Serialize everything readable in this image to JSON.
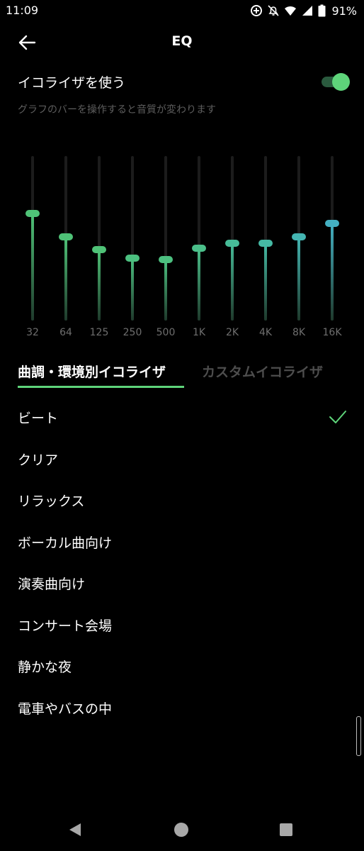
{
  "status_bar": {
    "time": "11:09",
    "battery_percent": "91%",
    "icons": [
      "data-saver-icon",
      "notifications-off-icon",
      "wifi-icon",
      "signal-icon",
      "battery-icon"
    ]
  },
  "header": {
    "title": "EQ",
    "back_icon": "arrow-left-icon"
  },
  "equalizer_toggle": {
    "label": "イコライザを使う",
    "enabled": true,
    "description": "グラフのバーを操作すると音質が変わります"
  },
  "eq_bands": [
    {
      "freq": "32",
      "level": 0.65,
      "color": "#4fc277"
    },
    {
      "freq": "64",
      "level": 0.51,
      "color": "#4fc277"
    },
    {
      "freq": "125",
      "level": 0.43,
      "color": "#4fc277"
    },
    {
      "freq": "250",
      "level": 0.38,
      "color": "#4cc080"
    },
    {
      "freq": "500",
      "level": 0.37,
      "color": "#4cc080"
    },
    {
      "freq": "1K",
      "level": 0.44,
      "color": "#4bbf8a"
    },
    {
      "freq": "2K",
      "level": 0.47,
      "color": "#47bc98"
    },
    {
      "freq": "4K",
      "level": 0.47,
      "color": "#45b9a4"
    },
    {
      "freq": "8K",
      "level": 0.51,
      "color": "#44b5b2"
    },
    {
      "freq": "16K",
      "level": 0.59,
      "color": "#44b0c2"
    }
  ],
  "tabs": [
    {
      "label": "曲調・環境別イコライザ",
      "active": true
    },
    {
      "label": "カスタムイコライザ",
      "active": false
    }
  ],
  "presets": [
    {
      "label": "ビート",
      "selected": true
    },
    {
      "label": "クリア",
      "selected": false
    },
    {
      "label": "リラックス",
      "selected": false
    },
    {
      "label": "ボーカル曲向け",
      "selected": false
    },
    {
      "label": "演奏曲向け",
      "selected": false
    },
    {
      "label": "コンサート会場",
      "selected": false
    },
    {
      "label": "静かな夜",
      "selected": false
    },
    {
      "label": "電車やバスの中",
      "selected": false
    }
  ],
  "colors": {
    "accent": "#5ed47a",
    "background": "#000000",
    "muted_text": "#5d5d5d"
  },
  "nav_bar": {
    "icons": [
      "nav-back-icon",
      "nav-home-icon",
      "nav-recents-icon"
    ]
  }
}
